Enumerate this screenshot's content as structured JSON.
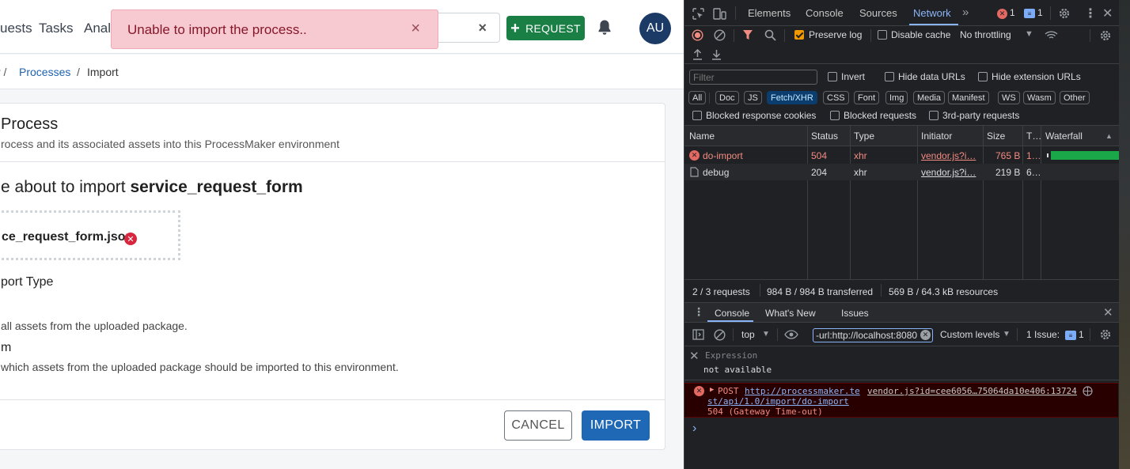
{
  "app": {
    "nav": {
      "links": [
        "uests",
        "Tasks",
        "Analy"
      ],
      "request_label": "REQUEST",
      "avatar_initials": "AU",
      "search_clear": "×"
    },
    "toast": {
      "message": "Unable to import the process..",
      "close": "×"
    },
    "breadcrumb": {
      "sep1": "r /",
      "processes": "Processes",
      "sep2": "/",
      "current": "Import"
    },
    "card": {
      "title": "Process",
      "description": "rocess and its associated assets into this ProcessMaker environment",
      "about_prefix": "e about to import ",
      "about_name": "service_request_form",
      "file_name": "ce_request_form.json",
      "import_type_label": "port Type",
      "option1_desc": "all assets from the uploaded package.",
      "option2_title": "m",
      "option2_desc": "which assets from the uploaded package should be imported to this environment.",
      "cancel_label": "CANCEL",
      "import_label": "IMPORT"
    }
  },
  "devtools": {
    "tabs": [
      "Elements",
      "Console",
      "Sources",
      "Network"
    ],
    "active_tab": "Network",
    "error_count": "1",
    "message_count": "1",
    "toolbar": {
      "preserve_log": "Preserve log",
      "disable_cache": "Disable cache",
      "throttling": "No throttling"
    },
    "filter": {
      "placeholder": "Filter",
      "invert": "Invert",
      "hide_data_urls": "Hide data URLs",
      "hide_ext_urls": "Hide extension URLs",
      "types": [
        "All",
        "Doc",
        "JS",
        "Fetch/XHR",
        "CSS",
        "Font",
        "Img",
        "Media",
        "Manifest",
        "WS",
        "Wasm",
        "Other"
      ],
      "active_type": "Fetch/XHR",
      "blocked_cookies": "Blocked response cookies",
      "blocked_requests": "Blocked requests",
      "third_party": "3rd-party requests"
    },
    "table": {
      "headers": [
        "Name",
        "Status",
        "Type",
        "Initiator",
        "Size",
        "T…",
        "Waterfall"
      ],
      "rows": [
        {
          "name": "do-import",
          "status": "504",
          "type": "xhr",
          "initiator": "vendor.js?i…",
          "size": "765 B",
          "time": "1…"
        },
        {
          "name": "debug",
          "status": "204",
          "type": "xhr",
          "initiator": "vendor.js?i…",
          "size": "219 B",
          "time": "6…"
        }
      ]
    },
    "summary": {
      "requests": "2 / 3 requests",
      "transferred": "984 B / 984 B transferred",
      "resources": "569 B / 64.3 kB resources"
    },
    "console": {
      "tabs": [
        "Console",
        "What's New",
        "Issues"
      ],
      "context": "top",
      "url_filter": "-url:http://localhost:8080",
      "levels": "Custom levels",
      "issues_label": "1 Issue:",
      "issues_count": "1",
      "expression_label": "Expression",
      "expression_value": "not available",
      "error": {
        "method": "POST",
        "url_part1": "http://processmaker.te",
        "url_part2": "st/api/1.0/import/do-import",
        "source": "vendor.js?id=cee6056…75064da10e406:13724",
        "status": "504 (Gateway Time-out)"
      },
      "prompt": "›"
    }
  },
  "colors": {
    "request_button": "#1a7f45",
    "import_button": "#1f68b6",
    "toast_bg": "#f7c9d0",
    "avatar_bg": "#1b3a66",
    "devtools_bg": "#202124",
    "devtools_accent": "#8ab4f8",
    "error_red": "#f28b82",
    "waterfall_green": "#1aa74a"
  }
}
